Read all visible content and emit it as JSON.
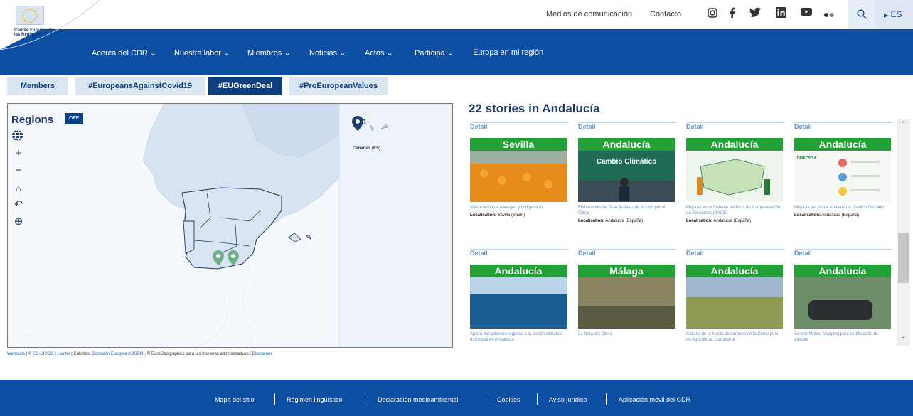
{
  "header": {
    "logo_text": "Comité Europeo de las Regiones",
    "media_link": "Medios de comunicación",
    "contact_link": "Contacto",
    "language": "ES",
    "social_icons": [
      "instagram-icon",
      "facebook-icon",
      "twitter-icon",
      "linkedin-icon",
      "youtube-icon",
      "flickr-icon"
    ]
  },
  "nav": {
    "items": [
      {
        "label": "Acerca del CDR",
        "dropdown": true
      },
      {
        "label": "Nuestra labor",
        "dropdown": true
      },
      {
        "label": "Miembros",
        "dropdown": true
      },
      {
        "label": "Noticias",
        "dropdown": true
      },
      {
        "label": "Actos",
        "dropdown": true
      },
      {
        "label": "Participa",
        "dropdown": true
      },
      {
        "label": "Europa en mi región",
        "dropdown": false
      }
    ]
  },
  "tabs": [
    {
      "label": "Members",
      "active": false
    },
    {
      "label": "#EuropeansAgainstCovid19",
      "active": false
    },
    {
      "label": "#EUGreenDeal",
      "active": true
    },
    {
      "label": "#ProEuropeanValues",
      "active": false
    }
  ],
  "map": {
    "regions_label": "Regions",
    "toggle_label": "OFF",
    "inset_label": "Canarias (ES)",
    "cluster_count": "1",
    "credits_links": [
      "Webtools",
      "© EC-GISCO",
      "Leaflet"
    ],
    "credits_text": "| Créditos:",
    "credits_link2": "Comisión Europea (GISCO)",
    "credits_text2": ", © EuroGeographics para las fronteras administrativas |",
    "credits_disclaimer": "Disclaimer"
  },
  "stories": {
    "title": "22 stories in Andalucía",
    "detail_label": "Detail",
    "location_label": "Localisation:",
    "cards": [
      {
        "band": "Sevilla",
        "caption": "Valorización de naranjas y codigestión",
        "location": "Sevilla (Spain)",
        "img_color": "#e89a2c"
      },
      {
        "band": "Andalucía",
        "caption": "Elaboración del Plan Andaluz de Acción por el Clima",
        "location": "Andalucía (España)",
        "img_color": "#1f6b55"
      },
      {
        "band": "Andalucía",
        "caption": "Mejoras en el Sistema Andaluz de Compensación de Emisiones (SACE)",
        "location": "Andalucía (España)",
        "img_color": "#e8f2e8"
      },
      {
        "band": "Andalucía",
        "caption": "Mejoras del Portal Andaluz de Cambio Climático",
        "location": "Andalucía (España)",
        "img_color": "#f4f7f4"
      },
      {
        "band": "Andalucía",
        "caption": "Apoyo del gobierno regional a la acción climática municipal en Andalucía",
        "location": "",
        "img_color": "#1e6ba5"
      },
      {
        "band": "Málaga",
        "caption": "La Ruta del Clima",
        "location": "",
        "img_color": "#6b6b4d"
      },
      {
        "band": "Andalucía",
        "caption": "Cálculo de la huella de carbono de la Consejería de Agricultura, Ganadería",
        "location": "",
        "img_color": "#7a8f4a"
      },
      {
        "band": "Andalucía",
        "caption": "Sensor Mobile Mapping para certificación de ayudas",
        "location": "",
        "img_color": "#5a7d5a"
      }
    ],
    "card_special_texts": [
      "Cambio Climático",
      "DIRECTO A"
    ]
  },
  "footer": {
    "items": [
      "Mapa del sitio",
      "Régimen lingüístico",
      "Declaración medioambiental",
      "Cookies",
      "Aviso jurídico",
      "Aplicación móvil del CDR"
    ]
  },
  "colors": {
    "nav_blue": "#0b4ea2",
    "tab_active": "#0b3f7f",
    "tab_inactive": "#dbe6f3",
    "band_green": "#21a035"
  }
}
